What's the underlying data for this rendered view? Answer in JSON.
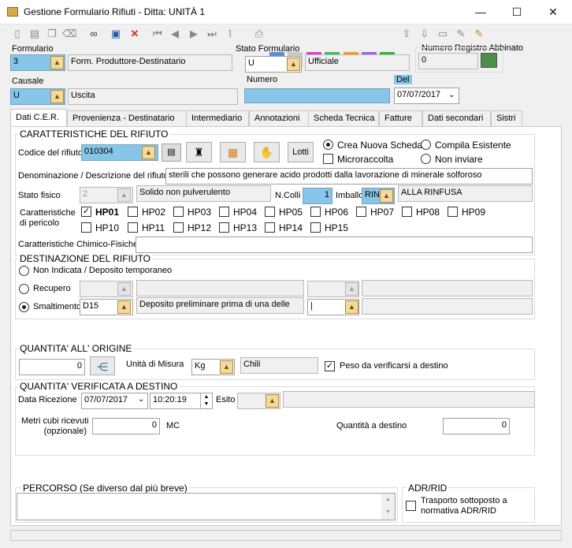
{
  "window": {
    "title": "Gestione Formulario Rifiuti - Ditta: UNITÀ 1",
    "minimize": "—",
    "maximize": "☐",
    "close": "✕"
  },
  "toolbar": {
    "icons": [
      "new-doc-icon",
      "open-doc-icon",
      "copy-icon",
      "erase-icon",
      "search-binoculars-icon",
      "save-icon",
      "delete-icon",
      "first-record-icon",
      "prev-record-icon",
      "next-record-icon",
      "last-record-icon",
      "attach-icon",
      "print-icon",
      "print-blue-icon",
      "print-gray-icon",
      "print-pink-icon",
      "print-green-icon",
      "print-orange-icon",
      "print-purple-icon",
      "refresh-green-icon",
      "upload-icon",
      "import-icon",
      "doc-icon",
      "sign-icon",
      "export-icon"
    ]
  },
  "header": {
    "formulario_label": "Formulario",
    "formulario_value": "3",
    "formulario_desc": "Form. Produttore-Destinatario",
    "stato_label": "Stato Formulario",
    "stato_value": "U",
    "stato_desc": "Ufficiale",
    "numreg_label": "Numero Registro Abbinato",
    "numreg_value": "0",
    "causale_label": "Causale",
    "causale_value": "U",
    "causale_desc": "Uscita",
    "numero_label": "Numero",
    "numero_value": "",
    "del_label": "Del",
    "del_value": "07/07/2017"
  },
  "tabs": [
    "Dati C.E.R.",
    "Provenienza - Destinatario",
    "Intermediario",
    "Annotazioni",
    "Scheda Tecnica",
    "Fatture",
    "Dati secondari",
    "Sistri"
  ],
  "cer": {
    "title": "CARATTERISTICHE DEL RIFIUTO",
    "codice_label": "Codice del rifiuto",
    "codice_value": "010304",
    "lotti_label": "Lotti",
    "radio_crea": "Crea Nuova Scheda",
    "radio_compila": "Compila Esistente",
    "check_micro": "Microraccolta",
    "radio_noninviare": "Non inviare",
    "denom_label": "Denominazione / Descrizione del rifiuto",
    "denom_value": "sterili che possono generare acido prodotti dalla lavorazione di minerale solforoso",
    "stato_fisico_label": "Stato fisico",
    "stato_fisico_value": "2",
    "stato_fisico_desc": "Solido non pulverulento",
    "ncolli_label": "N.Colli",
    "ncolli_value": "1",
    "imballo_label": "Imballo",
    "imballo_value": "RIN",
    "imballo_desc": "ALLA RINFUSA",
    "caratt_label_1": "Caratteristiche",
    "caratt_label_2": "di pericolo",
    "hp": [
      {
        "label": "HP01",
        "checked": true
      },
      {
        "label": "HP02",
        "checked": false
      },
      {
        "label": "HP03",
        "checked": false
      },
      {
        "label": "HP04",
        "checked": false
      },
      {
        "label": "HP05",
        "checked": false
      },
      {
        "label": "HP06",
        "checked": false
      },
      {
        "label": "HP07",
        "checked": false
      },
      {
        "label": "HP08",
        "checked": false
      },
      {
        "label": "HP09",
        "checked": false
      },
      {
        "label": "HP10",
        "checked": false
      },
      {
        "label": "HP11",
        "checked": false
      },
      {
        "label": "HP12",
        "checked": false
      },
      {
        "label": "HP13",
        "checked": false
      },
      {
        "label": "HP14",
        "checked": false
      },
      {
        "label": "HP15",
        "checked": false
      }
    ],
    "chimico_label": "Caratteristiche Chimico-Fisiche",
    "chimico_value": ""
  },
  "dest": {
    "title": "DESTINAZIONE DEL RIFIUTO",
    "non_indicata": "Non Indicata / Deposito temporaneo",
    "recupero": "Recupero",
    "recupero_value": "",
    "smaltimento": "Smaltimento",
    "smaltimento_value": "D15",
    "smaltimento_desc": "Deposito preliminare prima di una delle",
    "smaltimento_extra": "|"
  },
  "qta": {
    "title": "QUANTITA'  ALL' ORIGINE",
    "value": "0",
    "unita_label": "Unità di Misura",
    "unita_value": "Kg",
    "unita_desc": "Chili",
    "peso_label": "Peso da verificarsi a destino",
    "peso_checked": true
  },
  "qver": {
    "title": "QUANTITA' VERIFICATA A DESTINO",
    "data_label": "Data Ricezione",
    "data_value": "07/07/2017",
    "ora_value": "10:20:19",
    "esito_label": "Esito",
    "esito_value": "",
    "metri_label_1": "Metri cubi ricevuti",
    "metri_label_2": "(opzionale)",
    "metri_value": "0",
    "mc_label": "MC",
    "qdest_label": "Quantità a destino",
    "qdest_value": "0"
  },
  "percorso": {
    "title": "PERCORSO (Se diverso dal più breve)",
    "value": ""
  },
  "adr": {
    "title": "ADR/RID",
    "check_line1": "Trasporto sottoposto a",
    "check_line2": "normativa ADR/RID",
    "checked": false
  }
}
